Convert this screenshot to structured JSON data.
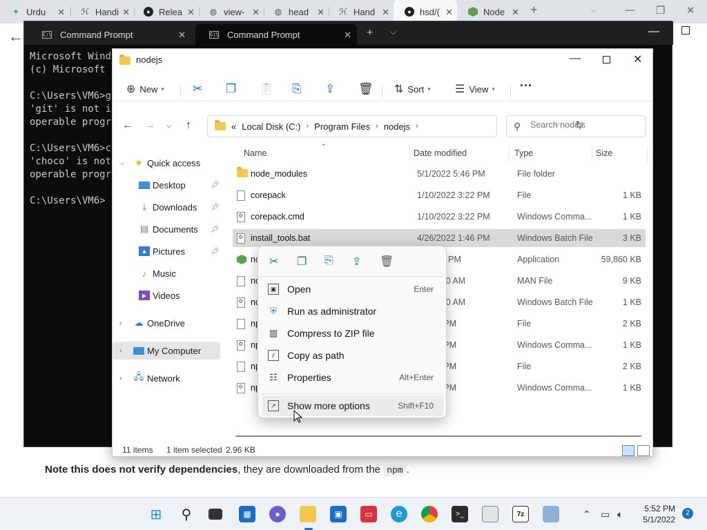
{
  "browser": {
    "tabs": [
      {
        "title": "Urdu"
      },
      {
        "title": "Handi"
      },
      {
        "title": "Relea"
      },
      {
        "title": "view-"
      },
      {
        "title": "head"
      },
      {
        "title": "Hand"
      },
      {
        "title": "hsd/("
      },
      {
        "title": "Node"
      }
    ],
    "page_text_bold": "Note this does not verify dependencies",
    "page_text_rest": ", they are downloaded from the",
    "page_code": "npm",
    "page_text_end": "."
  },
  "terminal": {
    "tabs": [
      {
        "title": "Command Prompt"
      },
      {
        "title": "Command Prompt"
      }
    ],
    "lines": [
      "Microsoft Wind",
      "(c) Microsoft",
      "",
      "C:\\Users\\VM6>g",
      "'git' is not i",
      "operable progr",
      "",
      "C:\\Users\\VM6>c",
      "'choco' is not",
      "operable progr",
      "",
      "C:\\Users\\VM6>"
    ]
  },
  "explorer": {
    "title": "nodejs",
    "cmdbar": {
      "new_label": "New",
      "sort_label": "Sort",
      "view_label": "View",
      "more": "···"
    },
    "address": {
      "prefix": "«",
      "crumbs": [
        "Local Disk (C:)",
        "Program Files",
        "nodejs"
      ]
    },
    "search_placeholder": "Search nodejs",
    "nav": {
      "quick_access": "Quick access",
      "pinned": [
        {
          "label": "Desktop",
          "icon": "desktop-icon",
          "pinned": true
        },
        {
          "label": "Downloads",
          "icon": "download-icon",
          "pinned": true
        },
        {
          "label": "Documents",
          "icon": "documents-icon",
          "pinned": true
        },
        {
          "label": "Pictures",
          "icon": "pictures-icon",
          "pinned": true
        },
        {
          "label": "Music",
          "icon": "music-icon",
          "pinned": false
        },
        {
          "label": "Videos",
          "icon": "videos-icon",
          "pinned": false
        }
      ],
      "onedrive": "OneDrive",
      "my_computer": "My Computer",
      "network": "Network"
    },
    "columns": {
      "name": "Name",
      "date": "Date modified",
      "type": "Type",
      "size": "Size"
    },
    "files": [
      {
        "name": "node_modules",
        "date": "5/1/2022 5:46 PM",
        "type": "File folder",
        "size": "",
        "icon": "folder"
      },
      {
        "name": "corepack",
        "date": "1/10/2022 3:22 PM",
        "type": "File",
        "size": "1 KB",
        "icon": "doc"
      },
      {
        "name": "corepack.cmd",
        "date": "1/10/2022 3:22 PM",
        "type": "Windows Comma...",
        "size": "1 KB",
        "icon": "cmd"
      },
      {
        "name": "install_tools.bat",
        "date": "4/26/2022 1:46 PM",
        "type": "Windows Batch File",
        "size": "3 KB",
        "icon": "cmd"
      },
      {
        "name": "nc",
        "date": "2 10:16 PM",
        "type": "Application",
        "size": "59,860 KB",
        "icon": "app"
      },
      {
        "name": "nc",
        "date": "21 12:30 AM",
        "type": "MAN File",
        "size": "9 KB",
        "icon": "doc"
      },
      {
        "name": "nc",
        "date": "21 12:30 AM",
        "type": "Windows Batch File",
        "size": "1 KB",
        "icon": "cmd"
      },
      {
        "name": "np",
        "date": "2 7:21 PM",
        "type": "File",
        "size": "2 KB",
        "icon": "doc"
      },
      {
        "name": "np",
        "date": "2 7:21 PM",
        "type": "Windows Comma...",
        "size": "1 KB",
        "icon": "cmd"
      },
      {
        "name": "np",
        "date": "2 7:21 PM",
        "type": "File",
        "size": "2 KB",
        "icon": "doc"
      },
      {
        "name": "np",
        "date": "2 7:21 PM",
        "type": "Windows Comma...",
        "size": "1 KB",
        "icon": "cmd"
      }
    ],
    "status": {
      "count": "11 items",
      "selected": "1 item selected",
      "size": "2.96 KB"
    }
  },
  "context_menu": {
    "items": [
      {
        "label": "Open",
        "shortcut": "Enter",
        "icon": "open-icon"
      },
      {
        "label": "Run as administrator",
        "shortcut": "",
        "icon": "shield-icon"
      },
      {
        "label": "Compress to ZIP file",
        "shortcut": "",
        "icon": "zip-icon"
      },
      {
        "label": "Copy as path",
        "shortcut": "",
        "icon": "copy-path-icon"
      },
      {
        "label": "Properties",
        "shortcut": "Alt+Enter",
        "icon": "properties-icon"
      }
    ],
    "more": {
      "label": "Show more options",
      "shortcut": "Shift+F10"
    }
  },
  "taskbar": {
    "time": "5:52 PM",
    "date": "5/1/2022",
    "notifications": "2",
    "accent": "#1a6fc4"
  }
}
